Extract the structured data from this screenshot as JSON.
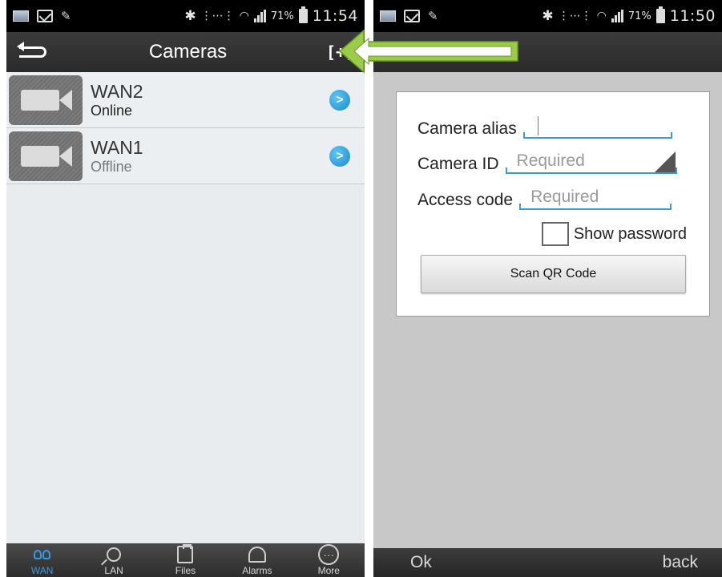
{
  "left": {
    "statusbar": {
      "battery_percent": "71%",
      "clock": "11:54"
    },
    "actionbar": {
      "title": "Cameras",
      "add_label": "[+]"
    },
    "cameras": [
      {
        "name": "WAN2",
        "status": "Online"
      },
      {
        "name": "WAN1",
        "status": "Offline"
      }
    ],
    "tabs": [
      {
        "label": "WAN",
        "icon": "wan-icon",
        "active": true
      },
      {
        "label": "LAN",
        "icon": "search-icon",
        "active": false
      },
      {
        "label": "Files",
        "icon": "clipboard-icon",
        "active": false
      },
      {
        "label": "Alarms",
        "icon": "bell-icon",
        "active": false
      },
      {
        "label": "More",
        "icon": "more-icon",
        "active": false
      }
    ]
  },
  "right": {
    "statusbar": {
      "battery_percent": "71%",
      "clock": "11:50"
    },
    "form": {
      "alias_label": "Camera alias",
      "alias_value": "",
      "camera_id_label": "Camera ID",
      "camera_id_placeholder": "Required",
      "access_code_label": "Access code",
      "access_code_placeholder": "Required",
      "show_password_label": "Show password",
      "scan_button": "Scan QR Code"
    },
    "bottombar": {
      "ok_label": "Ok",
      "back_label": "back"
    }
  },
  "colors": {
    "accent": "#3a9ae0",
    "arrow_fill": "#9ccb4a"
  }
}
